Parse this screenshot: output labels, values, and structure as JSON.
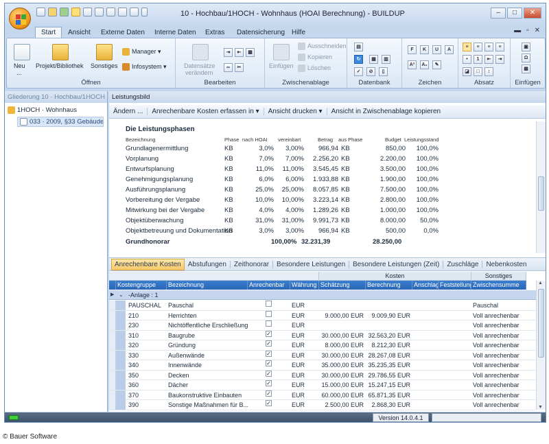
{
  "window": {
    "title": "10 - Hochbau/1HOCH - Wohnhaus (HOAI Berechnung) - BUILDUP",
    "controls": [
      "‒",
      "□",
      "✕"
    ]
  },
  "ribbon_tabs": [
    "Start",
    "Ansicht",
    "Externe Daten",
    "Interne Daten",
    "Extras",
    "Datensicherung",
    "Hilfe"
  ],
  "ribbon": {
    "oeffnen": {
      "label": "Öffnen",
      "neu": "Neu",
      "neu_sub": "...",
      "projekt": "Projekt/Bibliothek",
      "sonstiges": "Sonstiges",
      "manager": "Manager",
      "infosystem": "Infosystem"
    },
    "bearbeiten": {
      "label": "Bearbeiten",
      "datensaetze_1": "Datensätze",
      "datensaetze_2": "verändern"
    },
    "zwischenablage": {
      "label": "Zwischenablage",
      "einfuegen": "Einfügen",
      "ausschneiden": "Ausschneiden",
      "kopieren": "Kopieren",
      "loeschen": "Löschen"
    },
    "datenbank": {
      "label": "Datenbank"
    },
    "zeichen": {
      "label": "Zeichen"
    },
    "absatz": {
      "label": "Absatz"
    },
    "einfuegen": {
      "label": "Einfügen"
    }
  },
  "left_panel": {
    "header": "Gliederung 10 · Hochbau/1HOCH ...",
    "tree_root": "1HOCH · Wohnhaus",
    "tree_child": "033 · 2009, §33 Gebäude"
  },
  "main_panel": {
    "header": "Leistungsbild",
    "toolbar": [
      "Ändern ...",
      "Anrechenbare Kosten erfassen in",
      "Ansicht drucken",
      "Ansicht in Zwischenablage kopieren"
    ]
  },
  "report": {
    "heading": "Die Leistungsphasen",
    "columns": [
      "Bezeichnung",
      "Phase",
      "nach HOAI",
      "vereinbart",
      "Betrag",
      "aus Phase",
      "Budget",
      "Leistungsstand"
    ],
    "rows": [
      {
        "name": "Grundlagenermittlung",
        "phase": "KB",
        "hoai": "3,0%",
        "vereinbart": "3,00%",
        "betrag": "966,94",
        "aus": "KB",
        "budget": "850,00",
        "stand": "100,0%"
      },
      {
        "name": "Vorplanung",
        "phase": "KB",
        "hoai": "7,0%",
        "vereinbart": "7,00%",
        "betrag": "2.256,20",
        "aus": "KB",
        "budget": "2.200,00",
        "stand": "100,0%"
      },
      {
        "name": "Entwurfsplanung",
        "phase": "KB",
        "hoai": "11,0%",
        "vereinbart": "11,00%",
        "betrag": "3.545,45",
        "aus": "KB",
        "budget": "3.500,00",
        "stand": "100,0%"
      },
      {
        "name": "Genehmigungsplanung",
        "phase": "KB",
        "hoai": "6,0%",
        "vereinbart": "6,00%",
        "betrag": "1.933,88",
        "aus": "KB",
        "budget": "1.900,00",
        "stand": "100,0%"
      },
      {
        "name": "Ausführungsplanung",
        "phase": "KB",
        "hoai": "25,0%",
        "vereinbart": "25,00%",
        "betrag": "8.057,85",
        "aus": "KB",
        "budget": "7.500,00",
        "stand": "100,0%"
      },
      {
        "name": "Vorbereitung der Vergabe",
        "phase": "KB",
        "hoai": "10,0%",
        "vereinbart": "10,00%",
        "betrag": "3.223,14",
        "aus": "KB",
        "budget": "2.800,00",
        "stand": "100,0%"
      },
      {
        "name": "Mitwirkung bei der Vergabe",
        "phase": "KB",
        "hoai": "4,0%",
        "vereinbart": "4,00%",
        "betrag": "1.289,26",
        "aus": "KB",
        "budget": "1.000,00",
        "stand": "100,0%"
      },
      {
        "name": "Objektüberwachung",
        "phase": "KB",
        "hoai": "31,0%",
        "vereinbart": "31,00%",
        "betrag": "9.991,73",
        "aus": "KB",
        "budget": "8.000,00",
        "stand": "50,0%"
      },
      {
        "name": "Objektbetreuung und Dokumentation",
        "phase": "KB",
        "hoai": "3,0%",
        "vereinbart": "3,00%",
        "betrag": "966,94",
        "aus": "KB",
        "budget": "500,00",
        "stand": "0,0%"
      }
    ],
    "total": {
      "name": "Grundhonorar",
      "vereinbart": "100,00%",
      "betrag": "32.231,39",
      "budget": "28.250,00"
    }
  },
  "sub_tabs": [
    "Anrechenbare Kosten",
    "Abstufungen",
    "Zeithonorar",
    "Besondere Leistungen",
    "Besondere Leistungen (Zeit)",
    "Zuschläge",
    "Nebenkosten"
  ],
  "grid": {
    "band_kosten": "Kosten",
    "band_sonstiges": "Sonstiges",
    "columns": [
      "Kostengruppe",
      "Bezeichnung",
      "Anrechenbar",
      "Währung",
      "Schätzung",
      "Berechnung",
      "Anschlag",
      "Feststellung",
      "Zwischensumme"
    ],
    "group_label": "-Anlage : 1",
    "rows": [
      {
        "kg": "PAUSCHAL",
        "bez": "Pauschal",
        "chk": false,
        "wae": "EUR",
        "sch": "",
        "ber": "",
        "zw": "Pauschal"
      },
      {
        "kg": "210",
        "bez": "Herrichten",
        "chk": false,
        "wae": "EUR",
        "sch": "9.000,00 EUR",
        "ber": "9.009,90 EUR",
        "zw": "Voll anrechenbar"
      },
      {
        "kg": "230",
        "bez": "Nichtöffentliche Erschließung",
        "chk": false,
        "wae": "EUR",
        "sch": "",
        "ber": "",
        "zw": "Voll anrechenbar"
      },
      {
        "kg": "310",
        "bez": "Baugrube",
        "chk": true,
        "wae": "EUR",
        "sch": "30.000,00 EUR",
        "ber": "32.563,20 EUR",
        "zw": "Voll anrechenbar"
      },
      {
        "kg": "320",
        "bez": "Gründung",
        "chk": true,
        "wae": "EUR",
        "sch": "8.000,00 EUR",
        "ber": "8.212,30 EUR",
        "zw": "Voll anrechenbar"
      },
      {
        "kg": "330",
        "bez": "Außenwände",
        "chk": true,
        "wae": "EUR",
        "sch": "30.000,00 EUR",
        "ber": "28.267,08 EUR",
        "zw": "Voll anrechenbar"
      },
      {
        "kg": "340",
        "bez": "Innenwände",
        "chk": true,
        "wae": "EUR",
        "sch": "35.000,00 EUR",
        "ber": "35.235,35 EUR",
        "zw": "Voll anrechenbar"
      },
      {
        "kg": "350",
        "bez": "Decken",
        "chk": true,
        "wae": "EUR",
        "sch": "30.000,00 EUR",
        "ber": "29.786,55 EUR",
        "zw": "Voll anrechenbar"
      },
      {
        "kg": "360",
        "bez": "Dächer",
        "chk": true,
        "wae": "EUR",
        "sch": "15.000,00 EUR",
        "ber": "15.247,15 EUR",
        "zw": "Voll anrechenbar"
      },
      {
        "kg": "370",
        "bez": "Baukonstruktive Einbauten",
        "chk": true,
        "wae": "EUR",
        "sch": "60.000,00 EUR",
        "ber": "65.871,35 EUR",
        "zw": "Voll anrechenbar"
      },
      {
        "kg": "390",
        "bez": "Sonstige Maßnahmen für B...",
        "chk": true,
        "wae": "EUR",
        "sch": "2.500,00 EUR",
        "ber": "2.868,30 EUR",
        "zw": "Voll anrechenbar"
      }
    ]
  },
  "status": {
    "version": "Version 14.0.4.1"
  },
  "copyright": "© Bauer Software"
}
